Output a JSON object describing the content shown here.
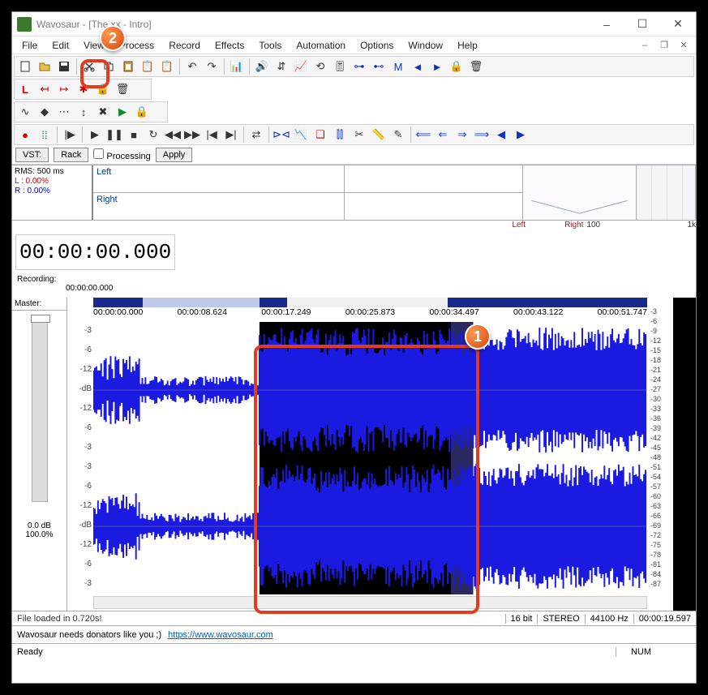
{
  "window": {
    "title": "Wavosaur - [The xx - Intro]",
    "buttons": {
      "min": "–",
      "max": "☐",
      "close": "✕",
      "mdi_min": "–",
      "mdi_max": "❐",
      "mdi_close": "✕"
    }
  },
  "menu": [
    "File",
    "Edit",
    "View",
    "Process",
    "Record",
    "Effects",
    "Tools",
    "Automation",
    "Options",
    "Window",
    "Help"
  ],
  "vst": {
    "vst": "VST:",
    "rack": "Rack",
    "processing": "Processing",
    "apply": "Apply"
  },
  "rms": {
    "title": "RMS: 500 ms",
    "l": "L : 0.00%",
    "r": "R : 0.00%"
  },
  "channels": {
    "left": "Left",
    "right": "Right"
  },
  "axis": {
    "left": "Left",
    "right": "Right",
    "a100": "100",
    "a1k": "1k"
  },
  "time_display": "00:00:00.000",
  "recording": {
    "label": "Recording:",
    "value": "00:00:00.000"
  },
  "master": {
    "label": "Master:",
    "db": "0.0 dB",
    "pct": "100.0%"
  },
  "ruler": [
    "00:00:00.000",
    "00:00:08.624",
    "00:00:17.249",
    "00:00:25.873",
    "00:00:34.497",
    "00:00:43.122",
    "00:00:51.747"
  ],
  "db_left": [
    "-3",
    "-6",
    "-12",
    "-dB",
    "-12",
    "-6",
    "-3",
    "-3",
    "-6",
    "-12",
    "-dB",
    "-12",
    "-6",
    "-3"
  ],
  "db_right": [
    "-3",
    "-6",
    "-9",
    "-12",
    "-15",
    "-18",
    "-21",
    "-24",
    "-27",
    "-30",
    "-33",
    "-36",
    "-39",
    "-42",
    "-45",
    "-48",
    "-51",
    "-54",
    "-57",
    "-60",
    "-63",
    "-66",
    "-69",
    "-72",
    "-75",
    "-78",
    "-81",
    "-84",
    "-87"
  ],
  "status": {
    "msg": "File loaded in 0.720s!",
    "bits": "16 bit",
    "mode": "STEREO",
    "rate": "44100 Hz",
    "pos": "00:00:19.597"
  },
  "donator": {
    "text": "Wavosaur needs donators like you ;)",
    "link": "https://www.wavosaur.com"
  },
  "bottom": {
    "ready": "Ready",
    "num": "NUM"
  },
  "callouts": {
    "one": "1",
    "two": "2"
  }
}
